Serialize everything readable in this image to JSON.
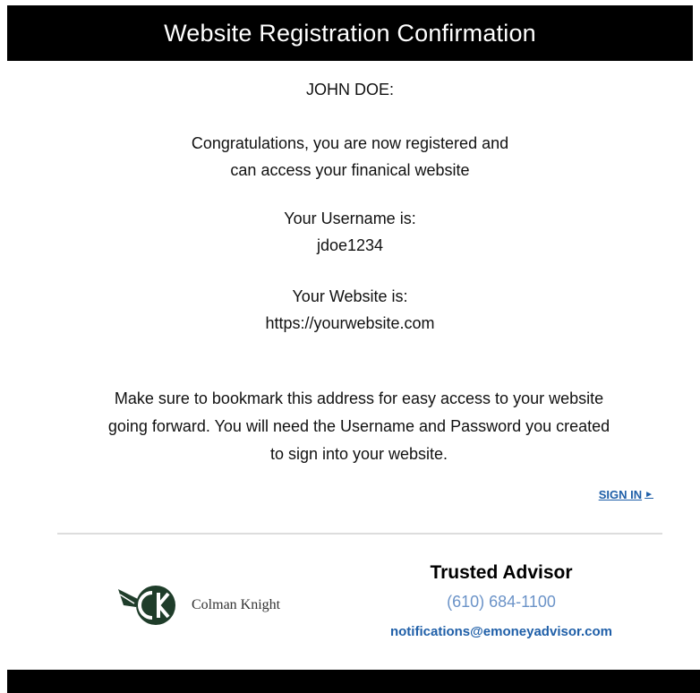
{
  "header": {
    "title": "Website Registration Confirmation"
  },
  "greeting": "JOHN DOE:",
  "congrats": {
    "line1": "Congratulations, you are now registered and",
    "line2": "can access your finanical website"
  },
  "username": {
    "label": "Your Username is:",
    "value": "jdoe1234"
  },
  "website": {
    "label": "Your Website is:",
    "value": "https://yourwebsite.com"
  },
  "notice": {
    "line1": "Make sure to bookmark this address for easy access to your website",
    "line2": "going forward. You will need the Username and Password you created",
    "line3": "to sign into your website."
  },
  "signin": {
    "label": "SIGN IN",
    "arrow": "►"
  },
  "logo": {
    "text": "Colman Knight",
    "icon": "ck-leaf-logo"
  },
  "contact": {
    "name": "Trusted Advisor",
    "phone": "(610) 684-1100",
    "email": "notifications@emoneyadvisor.com"
  },
  "colors": {
    "header_bg": "#000000",
    "link": "#1f5fa8",
    "phone": "#6b93c8",
    "logo_green": "#1f3d2a"
  }
}
